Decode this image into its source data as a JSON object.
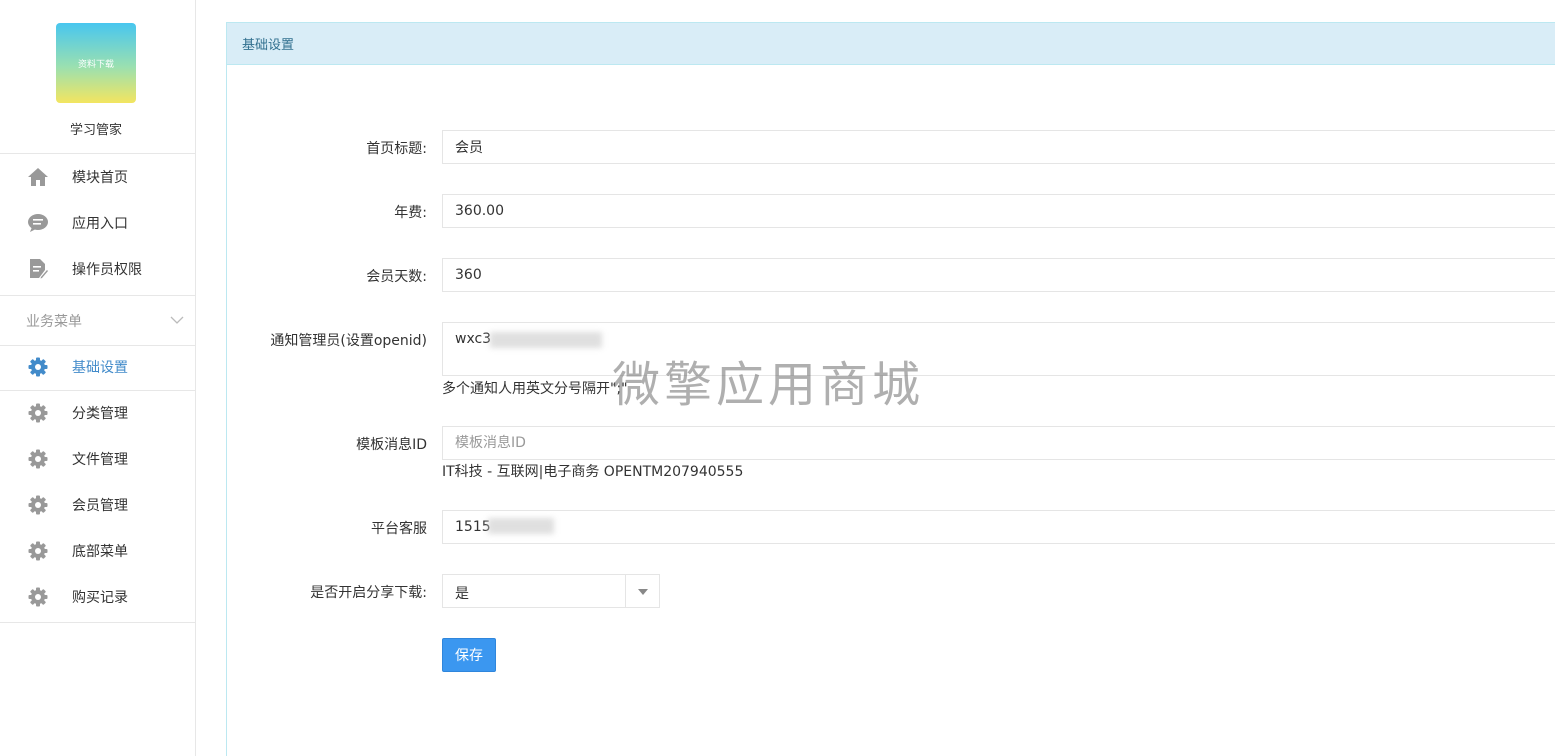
{
  "app": {
    "logo_text": "资料下载",
    "name": "学习管家"
  },
  "sidebar": {
    "top_items": [
      {
        "label": "模块首页",
        "icon": "home-icon"
      },
      {
        "label": "应用入口",
        "icon": "chat-bubble-icon"
      },
      {
        "label": "操作员权限",
        "icon": "document-edit-icon"
      }
    ],
    "section_label": "业务菜单",
    "business_items": [
      {
        "label": "基础设置",
        "icon": "gear-icon",
        "active": true
      },
      {
        "label": "分类管理",
        "icon": "gear-icon"
      },
      {
        "label": "文件管理",
        "icon": "gear-icon"
      },
      {
        "label": "会员管理",
        "icon": "gear-icon"
      },
      {
        "label": "底部菜单",
        "icon": "gear-icon"
      },
      {
        "label": "购买记录",
        "icon": "gear-icon"
      }
    ]
  },
  "panel": {
    "title": "基础设置"
  },
  "form": {
    "home_title": {
      "label": "首页标题:",
      "value": "会员"
    },
    "annual_fee": {
      "label": "年费:",
      "value": "360.00"
    },
    "member_days": {
      "label": "会员天数:",
      "value": "360"
    },
    "notify_admin": {
      "label": "通知管理员(设置openid)",
      "value": "wxc3",
      "help": "多个通知人用英文分号隔开\";\""
    },
    "template_id": {
      "label": "模板消息ID",
      "placeholder": "模板消息ID",
      "help": "IT科技 - 互联网|电子商务 OPENTM207940555"
    },
    "customer_service": {
      "label": "平台客服",
      "value": "1515"
    },
    "share_download": {
      "label": "是否开启分享下载:",
      "selected": "是"
    },
    "save_label": "保存"
  },
  "watermark": "微擎应用商城",
  "colors": {
    "accent": "#428bca",
    "panel_head_bg": "#d9edf7",
    "panel_head_text": "#31708f",
    "button_bg": "#3b97f0",
    "icon_gray": "#999999"
  }
}
